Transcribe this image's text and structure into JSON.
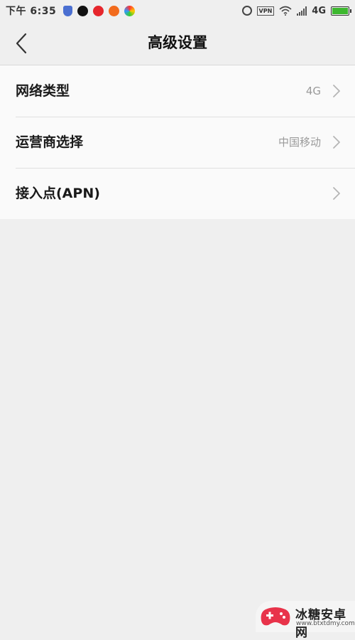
{
  "status_bar": {
    "time": "下午 6:35",
    "notification_icons": [
      "shield-icon",
      "qq-icon",
      "weibo-icon",
      "orange-app-icon",
      "color-app-icon"
    ],
    "vpn_label": "VPN",
    "network_label": "4G"
  },
  "header": {
    "title": "高级设置",
    "back_icon": "chevron-left-icon"
  },
  "settings": {
    "items": [
      {
        "label": "网络类型",
        "value": "4G"
      },
      {
        "label": "运营商选择",
        "value": "中国移动"
      },
      {
        "label": "接入点(APN)",
        "value": ""
      }
    ]
  },
  "watermark": {
    "brand": "冰糖安卓网",
    "url": "www.btxtdmy.com"
  },
  "colors": {
    "background": "#efefef",
    "list_background": "#fafafa",
    "battery": "#3db82f",
    "watermark_logo": "#e8334a"
  }
}
